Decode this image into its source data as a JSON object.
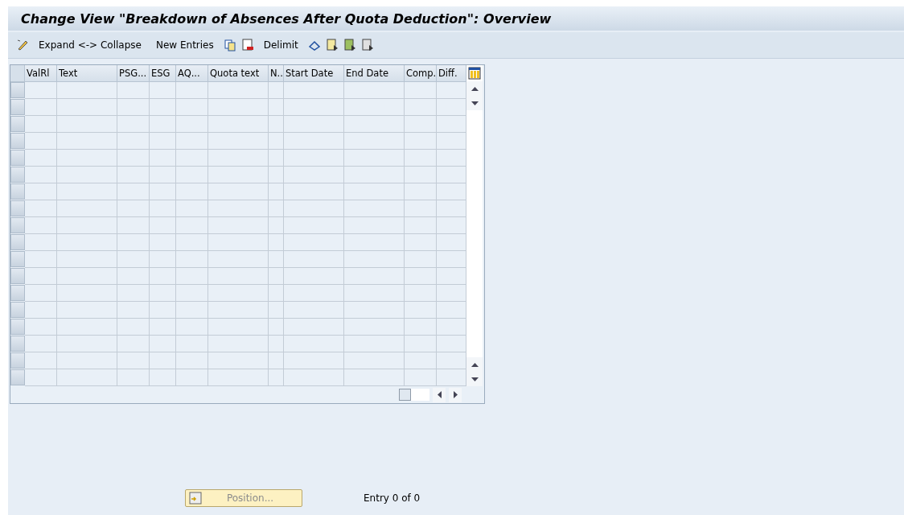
{
  "window": {
    "title": "Change View \"Breakdown of Absences After Quota Deduction\": Overview"
  },
  "toolbar": [
    {
      "kind": "icon"
    },
    {
      "kind": "text",
      "label": "Expand <-> Collapse"
    },
    {
      "kind": "text",
      "label": "New Entries"
    },
    {
      "kind": "icon"
    },
    {
      "kind": "icon"
    },
    {
      "kind": "text",
      "label": "Delimit"
    },
    {
      "kind": "icon"
    },
    {
      "kind": "icon"
    },
    {
      "kind": "icon"
    },
    {
      "kind": "icon"
    }
  ],
  "table": {
    "columns": [
      "ValRl",
      "Text",
      "PSG...",
      "ESG",
      "AQ...",
      "Quota text",
      "N..",
      "Start Date",
      "End Date",
      "Comp.",
      "Diff."
    ]
  },
  "footer": {
    "position_button": {
      "label": "Position...",
      "disabled": true
    },
    "entry_count": "Entry 0 of 0"
  }
}
